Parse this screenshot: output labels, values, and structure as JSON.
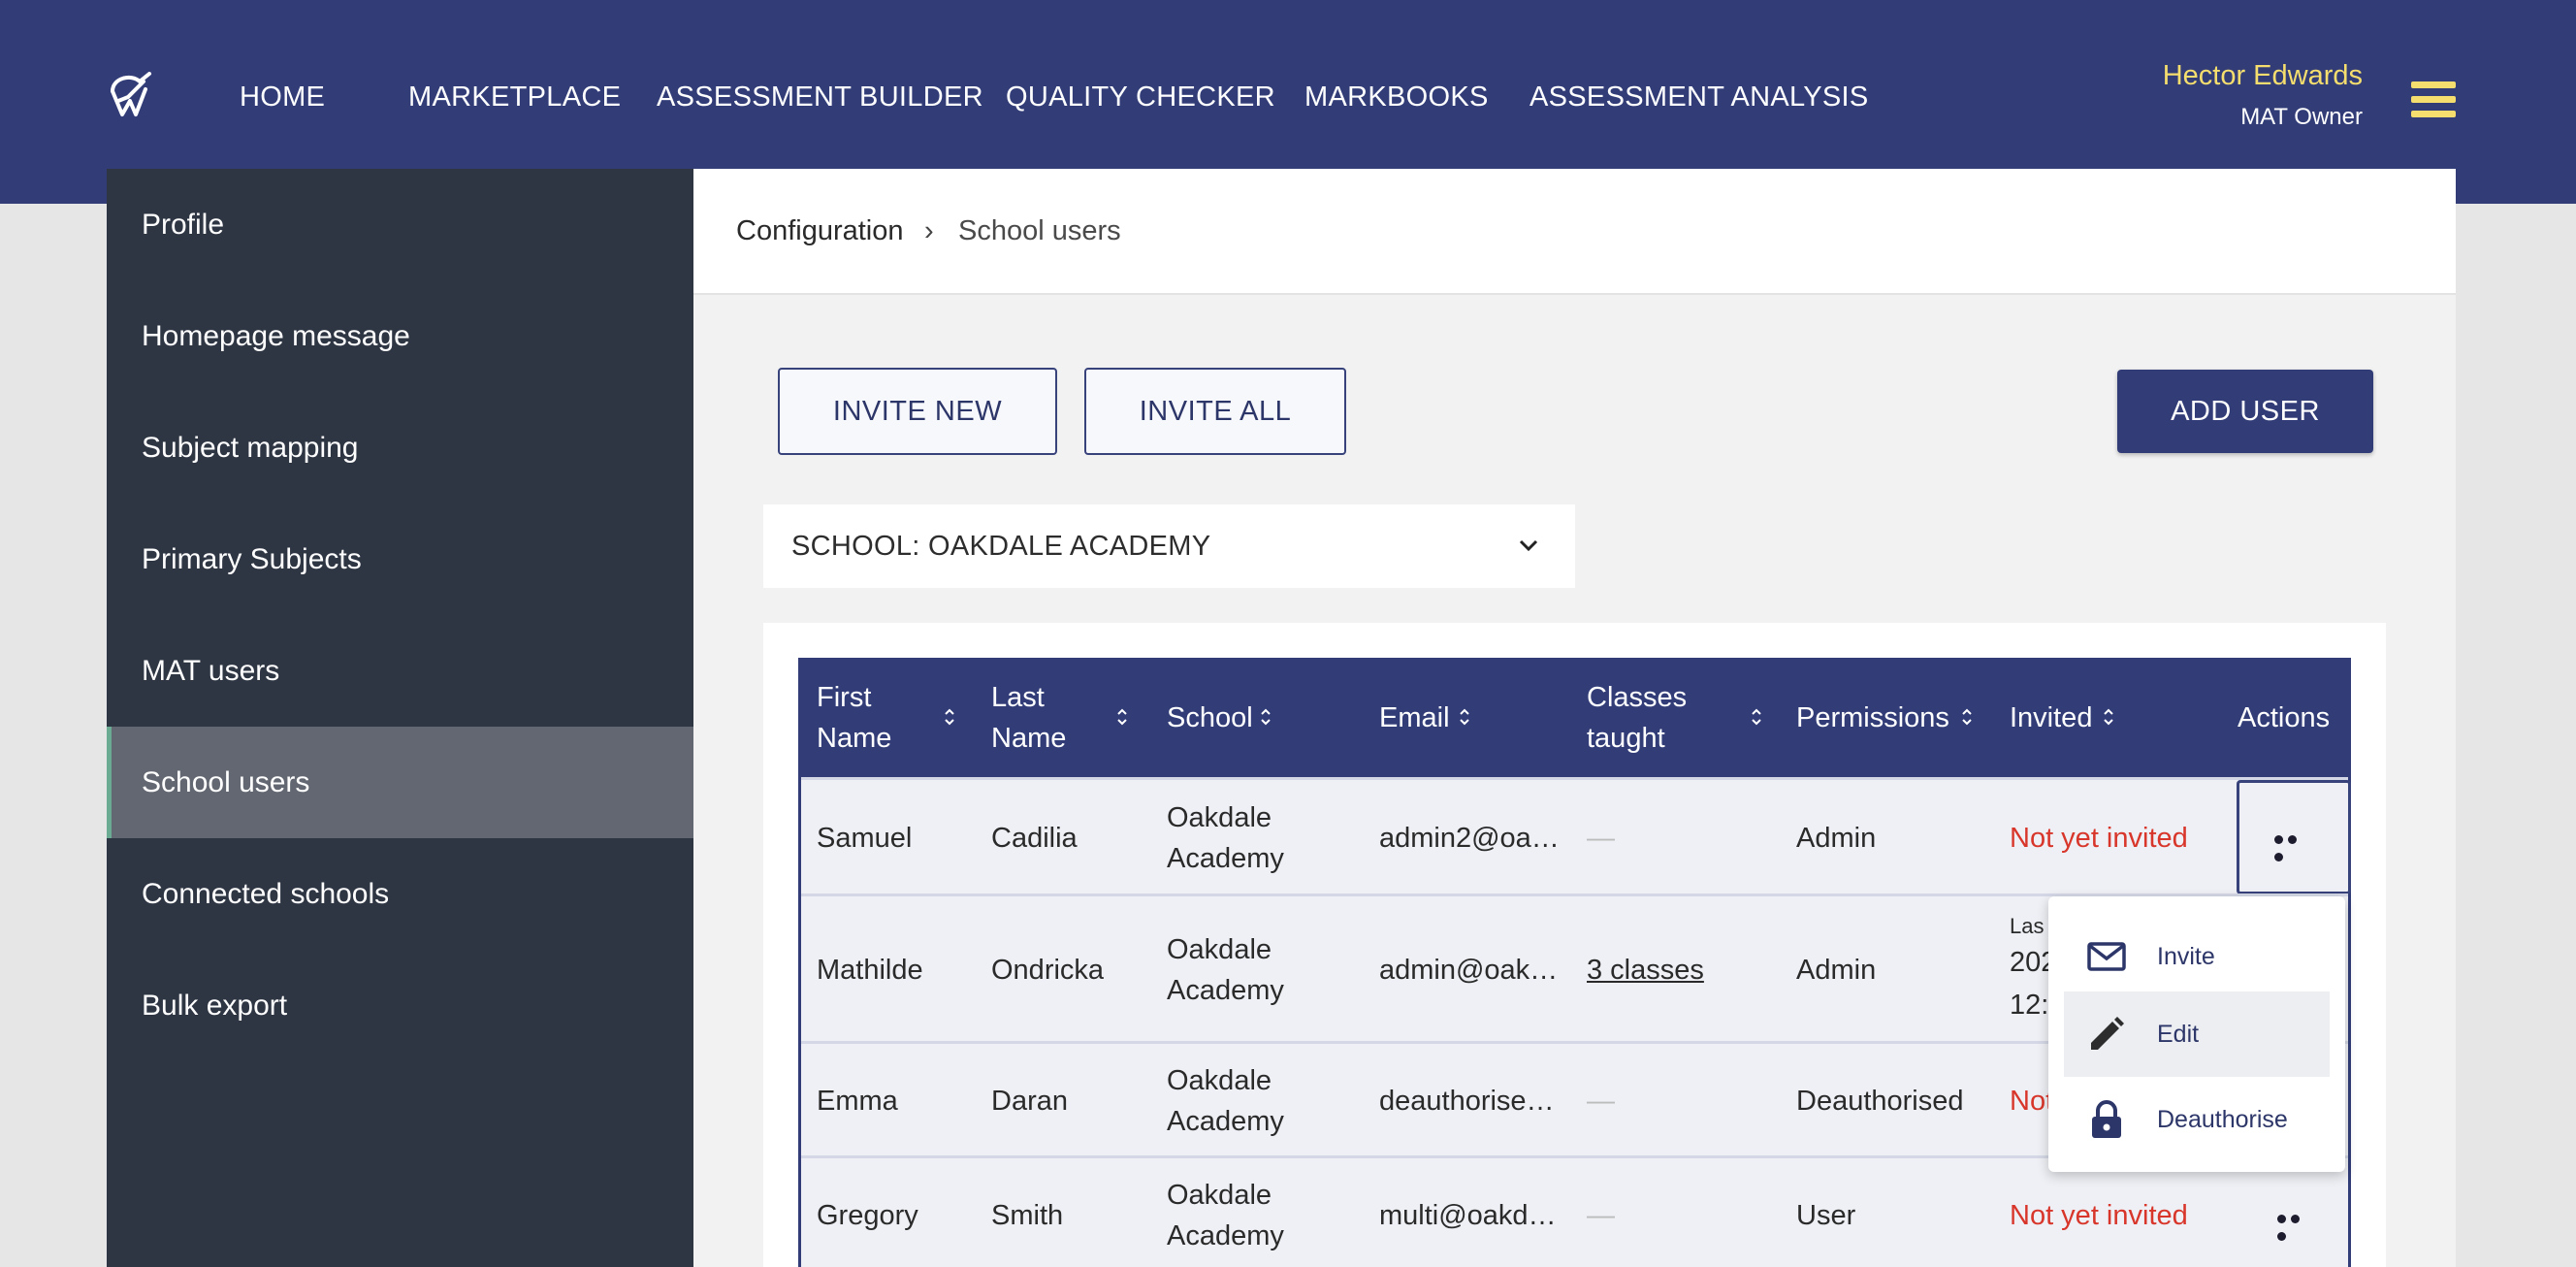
{
  "nav": {
    "items": [
      "HOME",
      "MARKETPLACE",
      "ASSESSMENT BUILDER",
      "QUALITY CHECKER",
      "MARKBOOKS",
      "ASSESSMENT ANALYSIS"
    ]
  },
  "user": {
    "name": "Hector Edwards",
    "role": "MAT Owner"
  },
  "sidebar": {
    "items": [
      "Profile",
      "Homepage message",
      "Subject mapping",
      "Primary Subjects",
      "MAT users",
      "School users",
      "Connected schools",
      "Bulk export"
    ],
    "active": "School users"
  },
  "breadcrumb": {
    "parent": "Configuration",
    "separator": "›",
    "current": "School users"
  },
  "toolbar": {
    "invite_new": "INVITE NEW",
    "invite_all": "INVITE ALL",
    "add_user": "ADD USER"
  },
  "school_select": {
    "value": "SCHOOL: OAKDALE ACADEMY"
  },
  "table": {
    "headers": {
      "first_name": "First Name",
      "last_name": "Last Name",
      "school": "School",
      "email": "Email",
      "classes": "Classes taught",
      "permissions": "Permissions",
      "invited": "Invited",
      "actions": "Actions"
    },
    "rows": [
      {
        "first": "Samuel",
        "last": "Cadilia",
        "school": "Oakdale Academy",
        "email": "admin2@oa…",
        "classes": "—",
        "permissions": "Admin",
        "invited": "Not yet invited"
      },
      {
        "first": "Mathilde",
        "last": "Ondricka",
        "school": "Oakdale Academy",
        "email": "admin@oak…",
        "classes": "3 classes",
        "permissions": "Admin",
        "invited_peek_1": "Las",
        "invited_peek_2": "202",
        "invited_peek_3": "12:"
      },
      {
        "first": "Emma",
        "last": "Daran",
        "school": "Oakdale Academy",
        "email": "deauthorise…",
        "classes": "—",
        "permissions": "Deauthorised",
        "invited_peek": "Not"
      },
      {
        "first": "Gregory",
        "last": "Smith",
        "school": "Oakdale Academy",
        "email": "multi@oakd…",
        "classes": "—",
        "permissions": "User",
        "invited": "Not yet invited"
      }
    ]
  },
  "action_menu": {
    "items": [
      "Invite",
      "Edit",
      "Deauthorise"
    ]
  },
  "colors": {
    "navy": "#323d78",
    "accent_yellow": "#f5dd6e",
    "sidebar": "#2e3543",
    "error_red": "#d8362b"
  }
}
